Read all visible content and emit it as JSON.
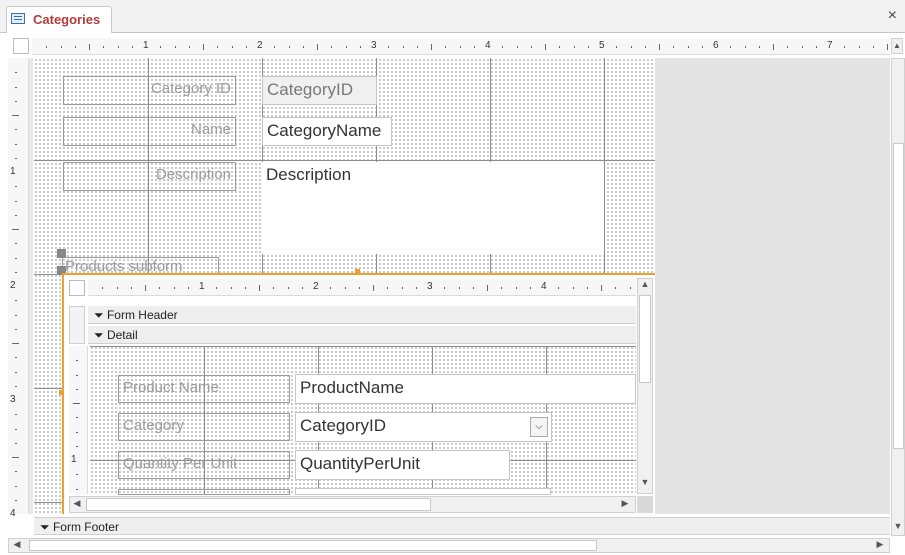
{
  "tab": {
    "title": "Categories",
    "icon": "form-icon",
    "close": "×"
  },
  "ruler": {
    "labels": [
      "1",
      "2",
      "3",
      "4",
      "5",
      "6",
      "7"
    ]
  },
  "ruler_v": {
    "labels": [
      "1",
      "2",
      "3",
      "4"
    ]
  },
  "main_form": {
    "labels": {
      "category_id": "Category ID",
      "name": "Name",
      "description": "Description",
      "products_subform": "Products subform"
    },
    "fields": {
      "category_id": "CategoryID",
      "category_name": "CategoryName",
      "description": "Description"
    }
  },
  "subform": {
    "ruler": {
      "labels": [
        "1",
        "2",
        "3",
        "4"
      ]
    },
    "ruler_v": {
      "labels": [
        "1"
      ]
    },
    "sections": {
      "form_header": "Form Header",
      "detail": "Detail"
    },
    "labels": {
      "product_name": "Product Name",
      "category": "Category",
      "quantity_per_unit": "Quantity Per Unit"
    },
    "fields": {
      "product_name": "ProductName",
      "category_id": "CategoryID",
      "quantity_per_unit": "QuantityPerUnit"
    }
  },
  "footer": {
    "form_footer": "Form Footer"
  },
  "colors": {
    "subform_border": "#f0a030",
    "tab_text": "#b33b3b",
    "label_text": "#9b9b9b",
    "designer_bg": "#e4e4e4"
  }
}
